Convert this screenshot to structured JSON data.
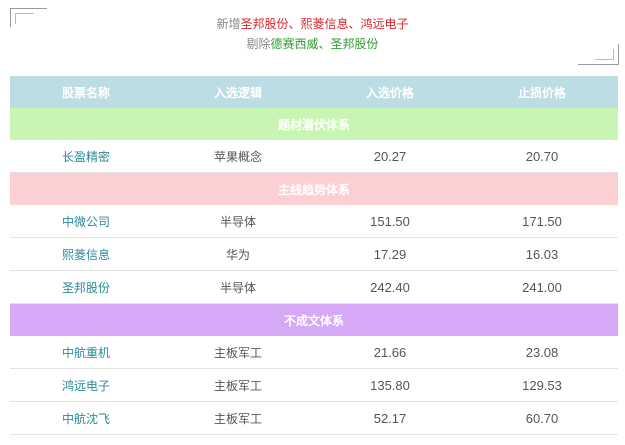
{
  "notice": {
    "added_prefix": "新增",
    "added_items": [
      "圣邦股份",
      "熙菱信息",
      "鸿远电子"
    ],
    "removed_prefix": "剔除",
    "removed_items": [
      "德赛西威",
      "圣邦股份"
    ],
    "separator": "、"
  },
  "table": {
    "headers": [
      "股票名称",
      "入选逻辑",
      "入选价格",
      "止损价格"
    ],
    "sections": [
      {
        "title": "题材潜伏体系",
        "color": "#c9f5b4",
        "rows": [
          {
            "name": "长盈精密",
            "logic": "苹果概念",
            "entry": "20.27",
            "stop": "20.70"
          }
        ]
      },
      {
        "title": "主线趋势体系",
        "color": "#fcd0d2",
        "rows": [
          {
            "name": "中微公司",
            "logic": "半导体",
            "entry": "151.50",
            "stop": "171.50"
          },
          {
            "name": "熙菱信息",
            "logic": "华为",
            "entry": "17.29",
            "stop": "16.03"
          },
          {
            "name": "圣邦股份",
            "logic": "半导体",
            "entry": "242.40",
            "stop": "241.00"
          }
        ]
      },
      {
        "title": "不成文体系",
        "color": "#d5a9f5",
        "rows": [
          {
            "name": "中航重机",
            "logic": "主板军工",
            "entry": "21.66",
            "stop": "23.08"
          },
          {
            "name": "鸿远电子",
            "logic": "主板军工",
            "entry": "135.80",
            "stop": "129.53"
          },
          {
            "name": "中航沈飞",
            "logic": "主板军工",
            "entry": "52.17",
            "stop": "60.70"
          }
        ]
      }
    ]
  }
}
